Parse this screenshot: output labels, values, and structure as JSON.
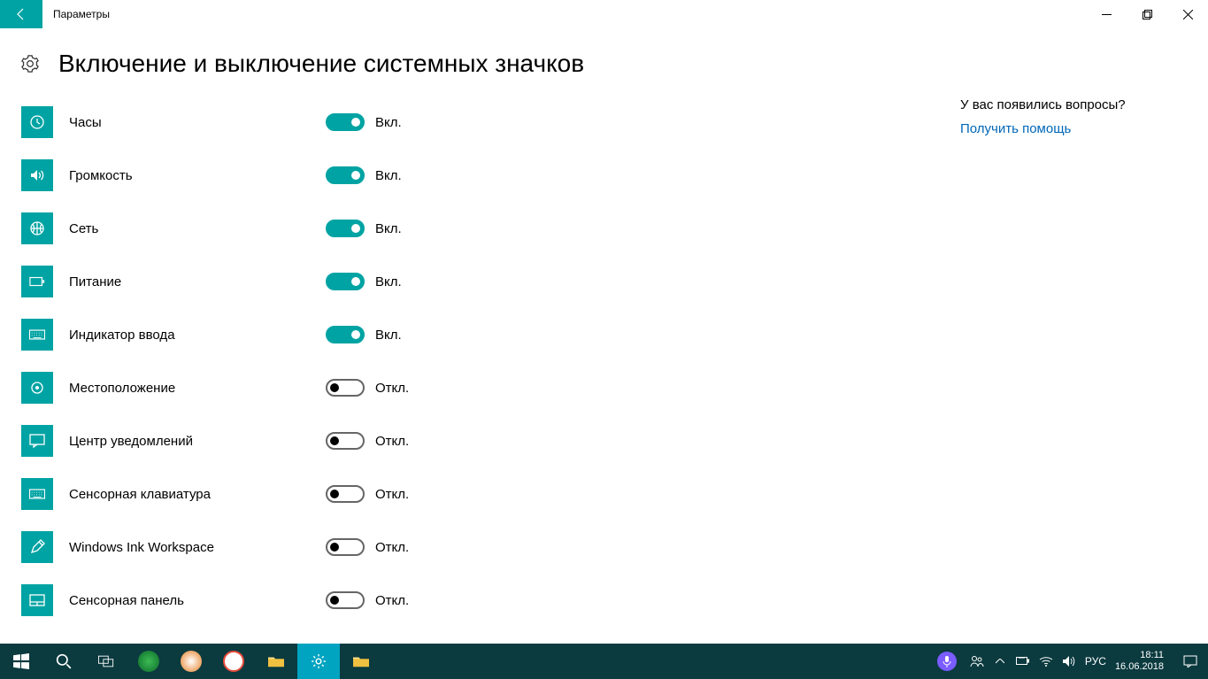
{
  "window": {
    "title": "Параметры"
  },
  "page": {
    "heading": "Включение и выключение системных значков"
  },
  "toggle_labels": {
    "on": "Вкл.",
    "off": "Откл."
  },
  "settings": [
    {
      "name": "clock",
      "label": "Часы",
      "on": true,
      "icon": "clock"
    },
    {
      "name": "volume",
      "label": "Громкость",
      "on": true,
      "icon": "volume"
    },
    {
      "name": "network",
      "label": "Сеть",
      "on": true,
      "icon": "globe"
    },
    {
      "name": "power",
      "label": "Питание",
      "on": true,
      "icon": "battery"
    },
    {
      "name": "input",
      "label": "Индикатор ввода",
      "on": true,
      "icon": "keyboard"
    },
    {
      "name": "location",
      "label": "Местоположение",
      "on": false,
      "icon": "location"
    },
    {
      "name": "action",
      "label": "Центр уведомлений",
      "on": false,
      "icon": "notifications"
    },
    {
      "name": "touchkb",
      "label": "Сенсорная клавиатура",
      "on": false,
      "icon": "keyboard"
    },
    {
      "name": "ink",
      "label": "Windows Ink Workspace",
      "on": false,
      "icon": "pen"
    },
    {
      "name": "touchpad",
      "label": "Сенсорная панель",
      "on": false,
      "icon": "touchpad"
    }
  ],
  "help": {
    "question": "У вас появились вопросы?",
    "link": "Получить помощь"
  },
  "taskbar": {
    "lang": "РУС",
    "time": "18:11",
    "date": "16.06.2018"
  }
}
